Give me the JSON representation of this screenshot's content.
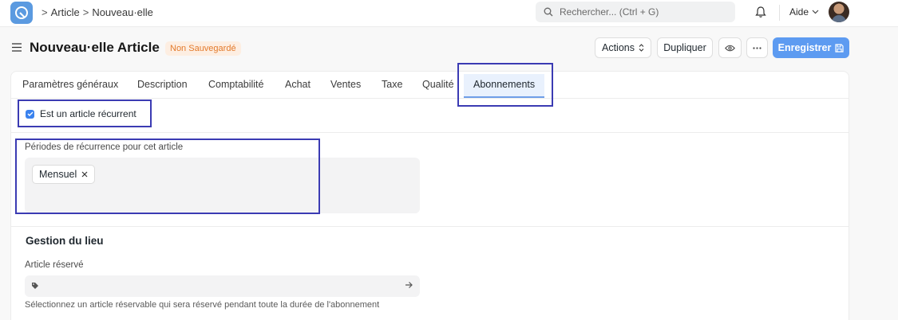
{
  "navbar": {
    "breadcrumb": [
      ">",
      "Article",
      ">",
      "Nouveau·elle"
    ],
    "search_placeholder": "Rechercher... (Ctrl + G)",
    "help_label": "Aide",
    "icons": [
      "app-logo-icon",
      "search-icon",
      "bell-icon",
      "chevron-down-icon",
      "avatar"
    ]
  },
  "page": {
    "title": "Nouveau·elle Article",
    "status_badge": "Non Sauvegardé",
    "actions_label": "Actions",
    "duplicate_label": "Dupliquer",
    "save_label": "Enregistrer"
  },
  "tabs": [
    {
      "label": "Paramètres généraux",
      "active": false
    },
    {
      "label": "Description",
      "active": false
    },
    {
      "label": "Comptabilité",
      "active": false
    },
    {
      "label": "Achat",
      "active": false
    },
    {
      "label": "Ventes",
      "active": false
    },
    {
      "label": "Taxe",
      "active": false
    },
    {
      "label": "Qualité",
      "active": false
    },
    {
      "label": "Abonnements",
      "active": true
    }
  ],
  "form": {
    "recurring_checkbox_label": "Est un article récurrent",
    "recurring_checked": true,
    "periods_label": "Périodes de récurrence pour cet article",
    "periods_values": [
      "Mensuel"
    ],
    "location_section_title": "Gestion du lieu",
    "reserved_item_label": "Article réservé",
    "reserved_item_value": "",
    "reserved_item_help": "Sélectionnez un article réservable qui sera réservé pendant toute la durée de l'abonnement"
  },
  "colors": {
    "accent": "#5d9bf1",
    "badge_text": "#e37a2b",
    "badge_bg": "#fdeee2",
    "highlight_box": "#3b3bb3",
    "checkbox": "#3a82ee"
  }
}
